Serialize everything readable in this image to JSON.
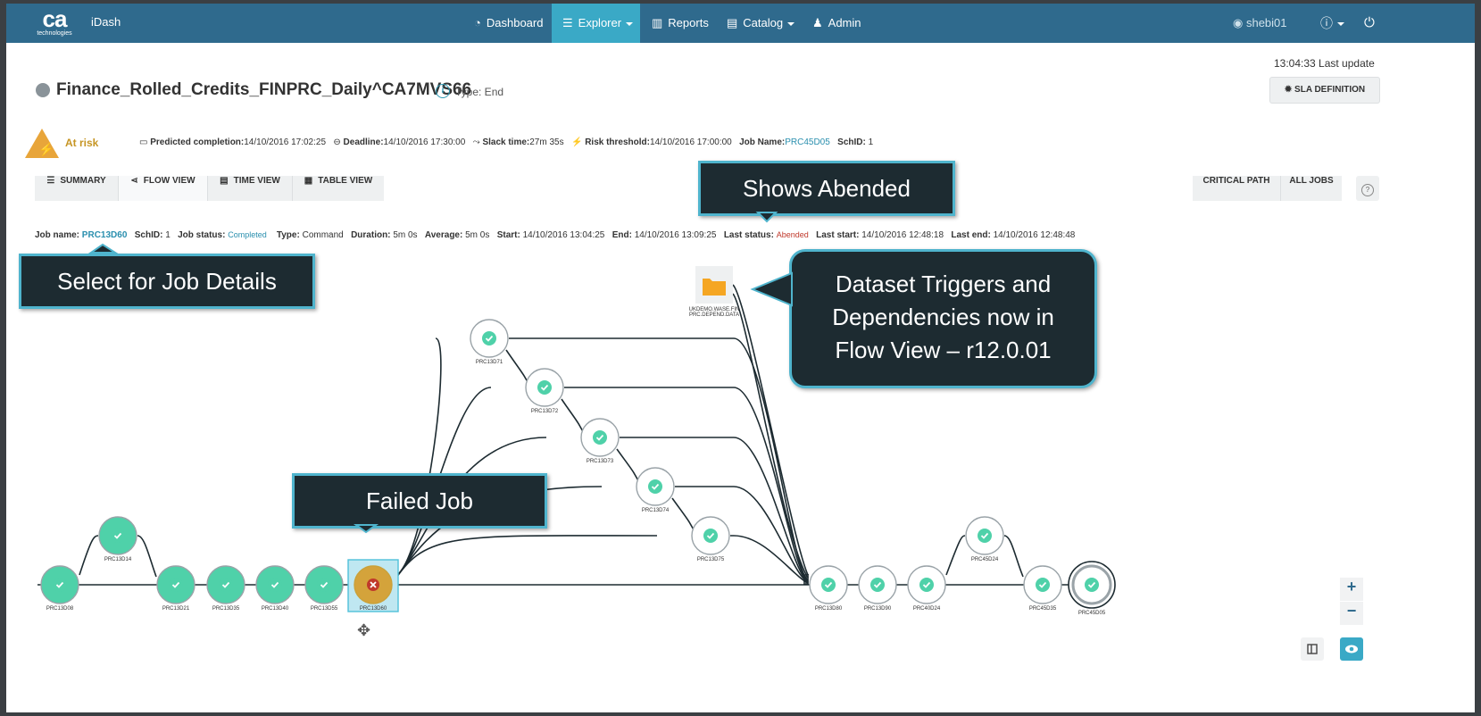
{
  "nav": {
    "logo_text": "ca",
    "logo_sub": "technologies",
    "app_name": "iDash",
    "items": [
      {
        "label": "Dashboard",
        "icon": "dashboard-icon"
      },
      {
        "label": "Explorer",
        "icon": "explorer-icon"
      },
      {
        "label": "Reports",
        "icon": "reports-icon"
      },
      {
        "label": "Catalog",
        "icon": "catalog-icon"
      },
      {
        "label": "Admin",
        "icon": "admin-icon"
      }
    ],
    "user": "shebi01",
    "help": "?"
  },
  "header": {
    "last_update": "13:04:33 Last update",
    "title": "Finance_Rolled_Credits_FINPRC_Daily^CA7MVS66",
    "type": "Type: End",
    "sla_button": "SLA DEFINITION"
  },
  "risk": {
    "status": "At risk",
    "predicted_label": "Predicted completion:",
    "predicted": "14/10/2016 17:02:25",
    "deadline_label": "Deadline:",
    "deadline": "14/10/2016 17:30:00",
    "slack_label": "Slack time:",
    "slack": "27m 35s",
    "threshold_label": "Risk threshold:",
    "threshold": "14/10/2016 17:00:00",
    "jobname_label": "Job Name:",
    "jobname": "PRC45D05",
    "schid_label": "SchID:",
    "schid": "1"
  },
  "tabs": [
    "SUMMARY",
    "FLOW VIEW",
    "TIME VIEW",
    "TABLE VIEW"
  ],
  "view_toggle": [
    "CRITICAL PATH",
    "ALL JOBS"
  ],
  "job": {
    "name_label": "Job name:",
    "name": "PRC13D60",
    "schid_label": "SchID:",
    "schid": "1",
    "status_label": "Job status:",
    "status": "Completed",
    "type_label": "Type:",
    "type": "Command",
    "duration_label": "Duration:",
    "duration": "5m 0s",
    "average_label": "Average:",
    "average": "5m 0s",
    "start_label": "Start:",
    "start": "14/10/2016 13:04:25",
    "end_label": "End:",
    "end": "14/10/2016 13:09:25",
    "last_status_label": "Last status:",
    "last_status": "Abended",
    "last_start_label": "Last start:",
    "last_start": "14/10/2016 12:48:18",
    "last_end_label": "Last end:",
    "last_end": "14/10/2016 12:48:48"
  },
  "flow": {
    "dataset_label_1": "UKDEMO.WASE.FIN",
    "dataset_label_2": "PRC.DEPEND.DATA",
    "nodes": [
      {
        "id": "PRC13D08",
        "status": "ok"
      },
      {
        "id": "PRC13D14",
        "status": "ok"
      },
      {
        "id": "PRC13D21",
        "status": "ok"
      },
      {
        "id": "PRC13D35",
        "status": "ok"
      },
      {
        "id": "PRC13D40",
        "status": "ok"
      },
      {
        "id": "PRC13D55",
        "status": "ok"
      },
      {
        "id": "PRC13D60",
        "status": "failed"
      },
      {
        "id": "PRC13D71",
        "status": "ok"
      },
      {
        "id": "PRC13D72",
        "status": "ok"
      },
      {
        "id": "PRC13D73",
        "status": "ok"
      },
      {
        "id": "PRC13D74",
        "status": "ok"
      },
      {
        "id": "PRC13D75",
        "status": "ok"
      },
      {
        "id": "PRC13D80",
        "status": "ok"
      },
      {
        "id": "PRC13D90",
        "status": "ok"
      },
      {
        "id": "PRC40D24",
        "status": "ok"
      },
      {
        "id": "PRC45D24",
        "status": "ok"
      },
      {
        "id": "PRC45D35",
        "status": "ok"
      },
      {
        "id": "PRC45D05",
        "status": "ok"
      }
    ],
    "colors": {
      "ok": "#4fd1a9",
      "failed": "#d4a33b",
      "edge": "#1d2b31"
    }
  },
  "callouts": {
    "abended": "Shows Abended",
    "select": "Select for Job Details",
    "failed": "Failed Job",
    "dataset": [
      "Dataset Triggers and",
      "Dependencies now in",
      "Flow View – r12.0.01"
    ]
  },
  "zoom": {
    "in": "+",
    "out": "−"
  }
}
